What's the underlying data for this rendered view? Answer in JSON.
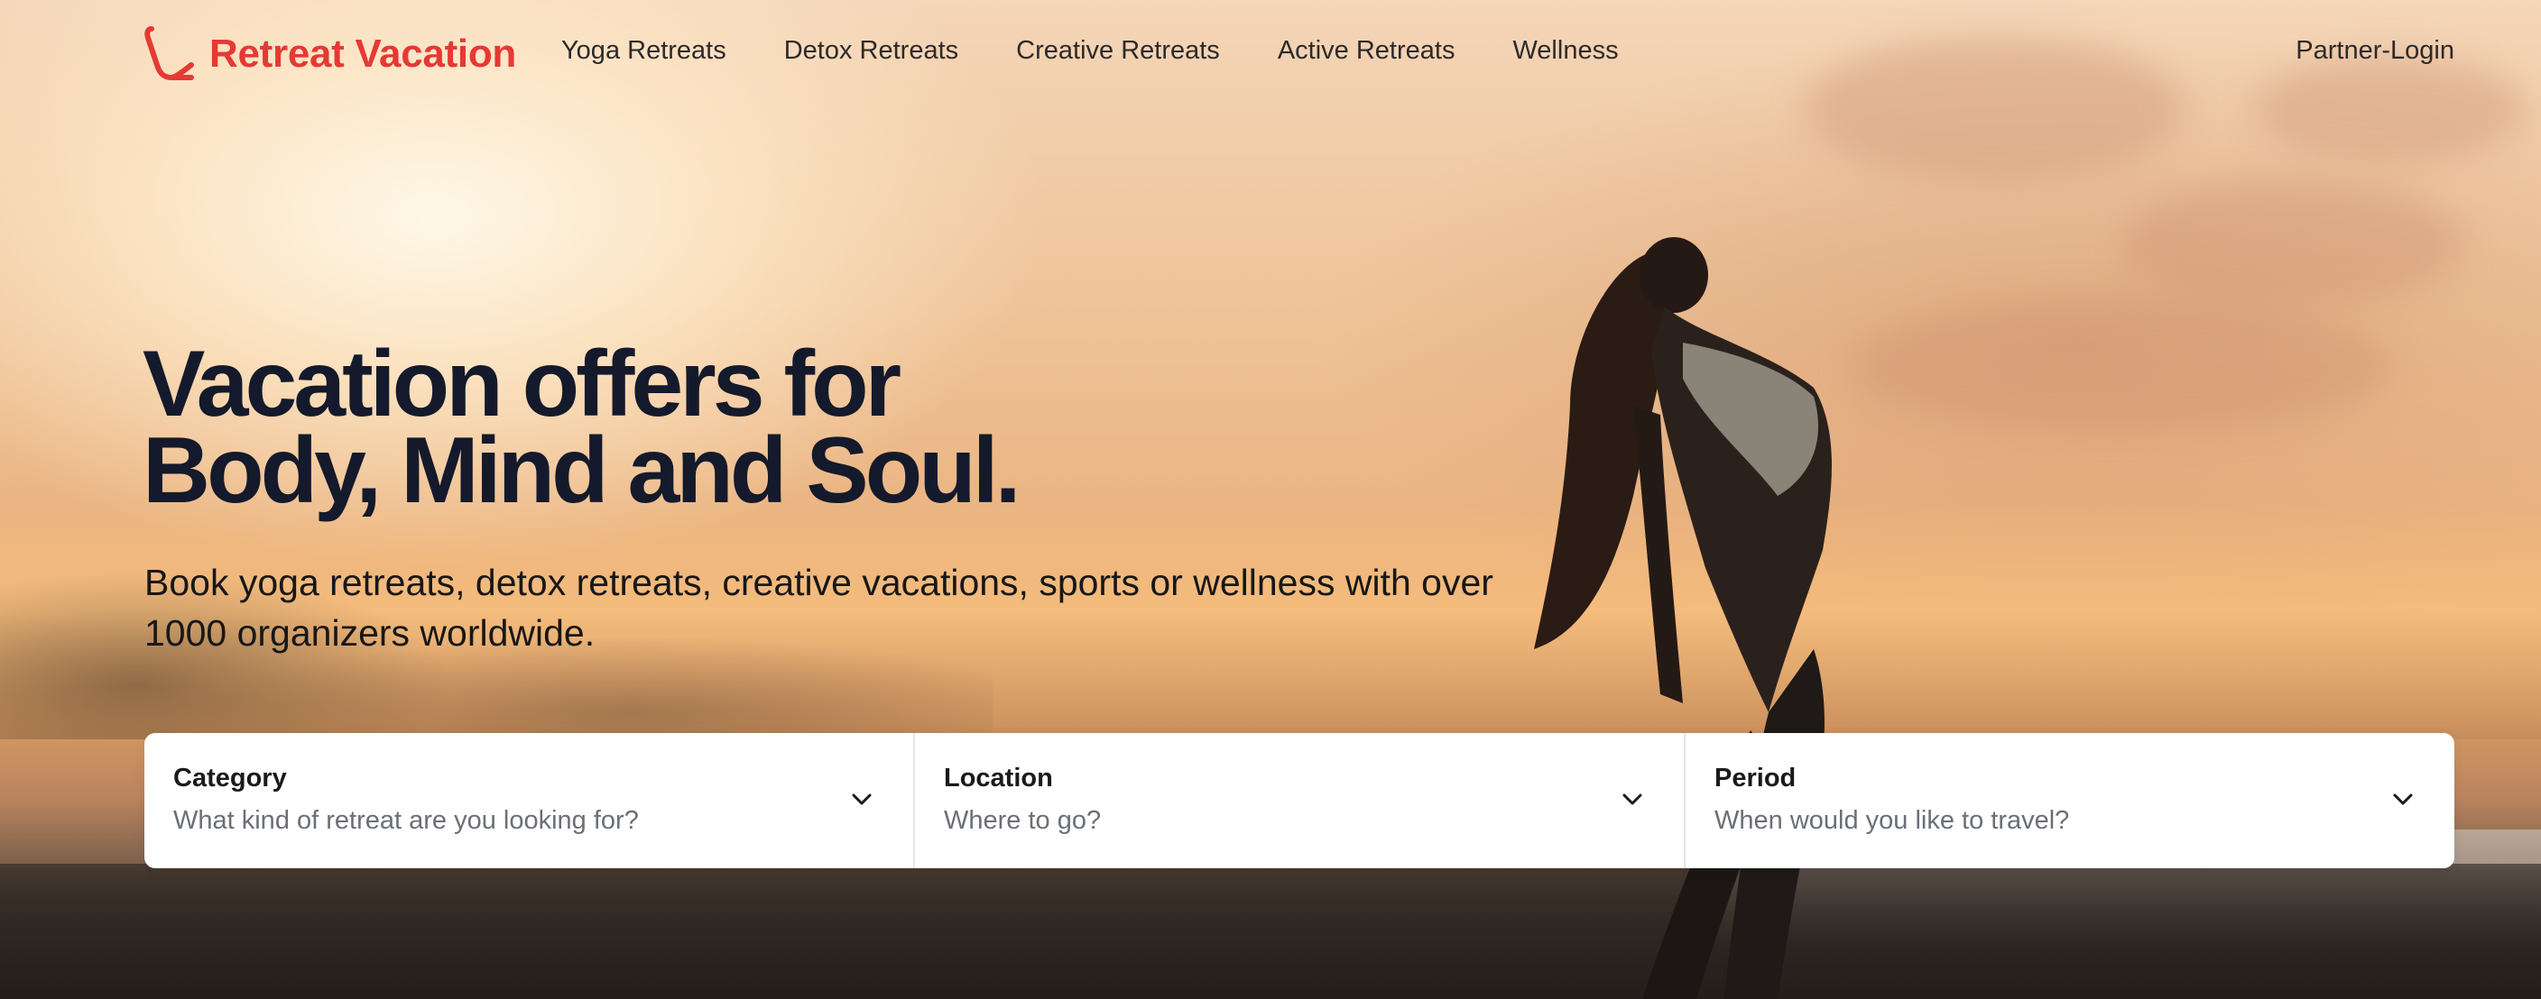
{
  "brand": {
    "name": "Retreat Vacation",
    "color": "#e53935",
    "icon": "brand-logo-icon"
  },
  "nav": {
    "items": [
      {
        "label": "Yoga Retreats"
      },
      {
        "label": "Detox Retreats"
      },
      {
        "label": "Creative Retreats"
      },
      {
        "label": "Active Retreats"
      },
      {
        "label": "Wellness"
      }
    ],
    "partner_login": "Partner-Login"
  },
  "hero": {
    "headline_line1": "Vacation offers for",
    "headline_line2": "Body, Mind and Soul.",
    "subtitle": "Book yoga retreats, detox retreats, creative vacations, sports or wellness with over 1000 organizers worldwide.",
    "background": "sunset-beach-woman-backbend-photo"
  },
  "search": {
    "fields": [
      {
        "label": "Category",
        "placeholder": "What kind of retreat are you looking for?",
        "icon": "chevron-down-icon"
      },
      {
        "label": "Location",
        "placeholder": "Where to go?",
        "icon": "chevron-down-icon"
      },
      {
        "label": "Period",
        "placeholder": "When would you like to travel?",
        "icon": "chevron-down-icon"
      }
    ]
  }
}
